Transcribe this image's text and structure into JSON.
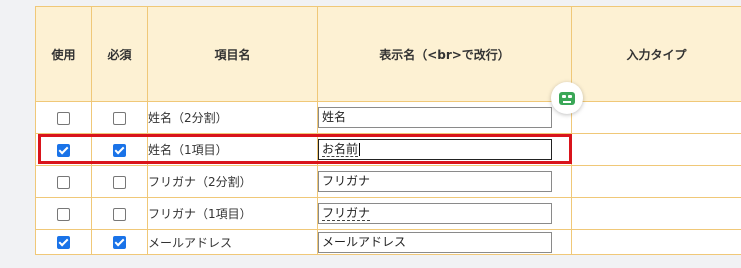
{
  "headers": {
    "use": "使用",
    "required": "必須",
    "item_name": "項目名",
    "display_name": "表示名（<br>で改行）",
    "input_type": "入力タイプ"
  },
  "rows": [
    {
      "use": false,
      "required": false,
      "item_name": "姓名（2分割）",
      "display_name": "姓名"
    },
    {
      "use": true,
      "required": true,
      "item_name": "姓名（1項目）",
      "display_name": "お名前"
    },
    {
      "use": false,
      "required": false,
      "item_name": "フリガナ（2分割）",
      "display_name": "フリガナ"
    },
    {
      "use": false,
      "required": false,
      "item_name": "フリガナ（1項目）",
      "display_name": "フリガナ"
    },
    {
      "use": true,
      "required": true,
      "item_name": "メールアドレス",
      "display_name": "メールアドレス"
    }
  ],
  "colors": {
    "header_bg": "#fdf1d3",
    "border": "#f0c878",
    "checkbox_checked": "#1a73e8",
    "highlight": "#d9141b",
    "extension_icon": "#3aa757"
  },
  "icons": {
    "extension": "robot-extension-icon"
  },
  "annotation": {
    "highlighted_row": 1
  }
}
